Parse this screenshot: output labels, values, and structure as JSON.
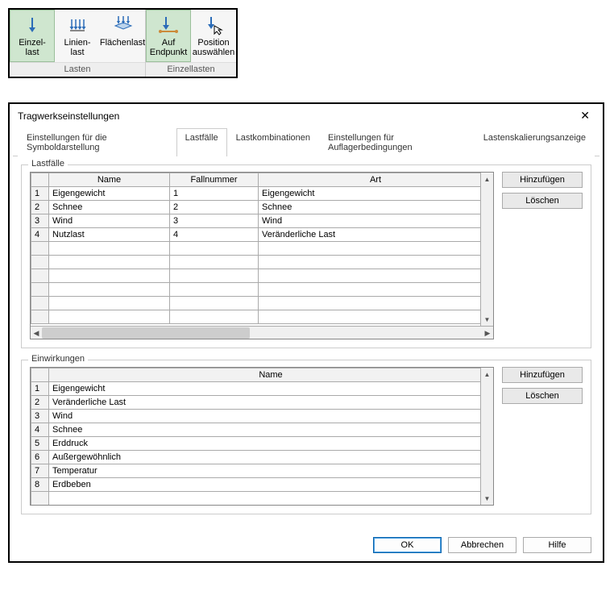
{
  "ribbon": {
    "buttons": [
      {
        "line1": "Einzel-",
        "line2": "last",
        "icon": "einzellast",
        "selected": true
      },
      {
        "line1": "Linien-",
        "line2": "last",
        "icon": "linienlast",
        "selected": false
      },
      {
        "line1": "Flächenlast",
        "line2": "",
        "icon": "flaechenlast",
        "selected": false
      },
      {
        "line1": "Auf",
        "line2": "Endpunkt",
        "icon": "endpunkt",
        "selected": true
      },
      {
        "line1": "Position",
        "line2": "auswählen",
        "icon": "position",
        "selected": false
      }
    ],
    "group_labels": {
      "lasten": "Lasten",
      "einzellasten": "Einzellasten"
    }
  },
  "dialog": {
    "title": "Tragwerkseinstellungen",
    "tabs": [
      "Einstellungen für die Symboldarstellung",
      "Lastfälle",
      "Lastkombinationen",
      "Einstellungen für Auflagerbedingungen",
      "Lastenskalierungsanzeige"
    ],
    "active_tab": 1,
    "lastfaelle": {
      "title": "Lastfälle",
      "headers": {
        "name": "Name",
        "fallnummer": "Fallnummer",
        "art": "Art"
      },
      "rows": [
        {
          "n": "1",
          "name": "Eigengewicht",
          "num": "1",
          "art": "Eigengewicht"
        },
        {
          "n": "2",
          "name": "Schnee",
          "num": "2",
          "art": "Schnee"
        },
        {
          "n": "3",
          "name": "Wind",
          "num": "3",
          "art": "Wind"
        },
        {
          "n": "4",
          "name": "Nutzlast",
          "num": "4",
          "art": "Veränderliche Last"
        }
      ],
      "add": "Hinzufügen",
      "del": "Löschen"
    },
    "einwirkungen": {
      "title": "Einwirkungen",
      "headers": {
        "name": "Name"
      },
      "rows": [
        {
          "n": "1",
          "name": "Eigengewicht"
        },
        {
          "n": "2",
          "name": "Veränderliche Last"
        },
        {
          "n": "3",
          "name": "Wind"
        },
        {
          "n": "4",
          "name": "Schnee"
        },
        {
          "n": "5",
          "name": "Erddruck"
        },
        {
          "n": "6",
          "name": "Außergewöhnlich"
        },
        {
          "n": "7",
          "name": "Temperatur"
        },
        {
          "n": "8",
          "name": "Erdbeben"
        }
      ],
      "add": "Hinzufügen",
      "del": "Löschen"
    },
    "buttons": {
      "ok": "OK",
      "cancel": "Abbrechen",
      "help": "Hilfe"
    }
  }
}
